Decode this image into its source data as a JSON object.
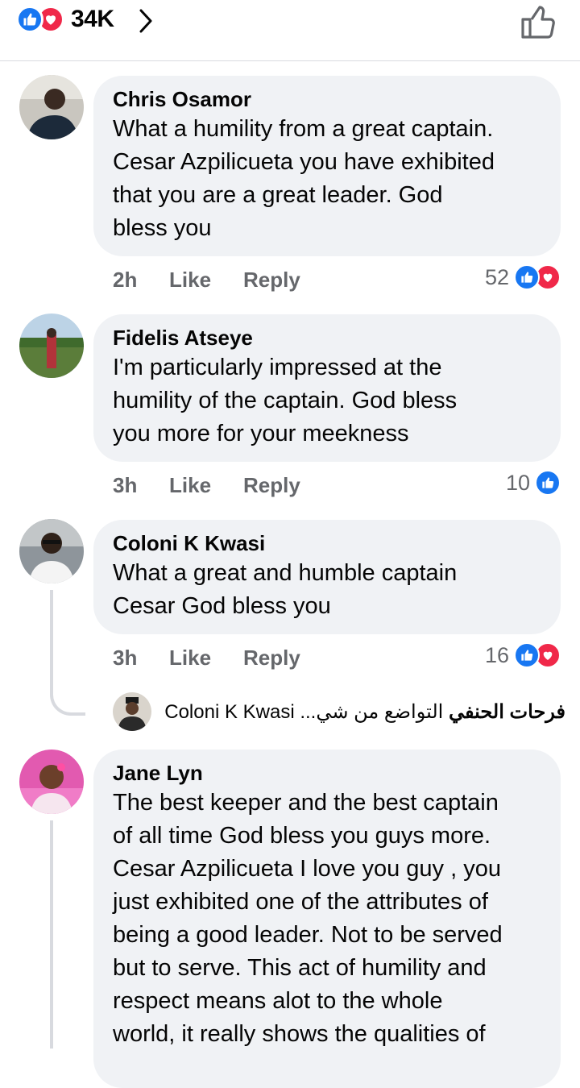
{
  "header": {
    "reaction_count": "34K",
    "icons": [
      "like-icon",
      "love-icon",
      "chevron-right-icon",
      "thumbs-up-outline-icon"
    ]
  },
  "comments": [
    {
      "name": "Chris Osamor",
      "text": "What a humility from a great captain.\nCesar Azpilicueta you have exhibited\nthat you are a great leader.  God\nbless you",
      "time": "2h",
      "like": "Like",
      "reply": "Reply",
      "reactions": "52"
    },
    {
      "name": "Fidelis Atseye",
      "text": "I'm particularly impressed at the\nhumility of the captain.  God bless\nyou more for your meekness",
      "time": "3h",
      "like": "Like",
      "reply": "Reply",
      "reactions": "10"
    },
    {
      "name": "Coloni K Kwasi",
      "text": "What a great and humble captain\nCesar God bless you",
      "time": "3h",
      "like": "Like",
      "reply": "Reply",
      "reactions": "16"
    },
    {
      "name": "Jane Lyn",
      "text": "The best keeper and the best captain\nof all time God bless you guys more.\nCesar Azpilicueta  I love you guy , you\njust exhibited one of the attributes of\nbeing a good leader. Not to be served\nbut to serve. This act of humility and\nrespect means alot to the whole\nworld, it really shows the qualities of"
    }
  ],
  "reply_preview": {
    "author": "فرحات الحنفي",
    "text": "التواضع من شي... Coloni K Kwasi"
  },
  "colors": {
    "accent_like": "#1877f2",
    "accent_love": "#f02849",
    "bubble": "#f0f2f5",
    "meta": "#65676b"
  }
}
